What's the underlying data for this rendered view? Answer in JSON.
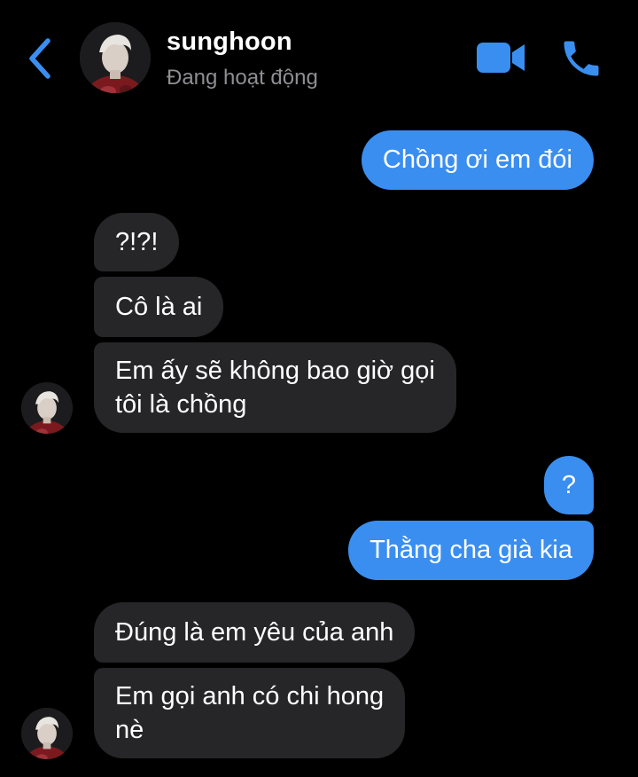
{
  "header": {
    "contact_name": "sunghoon",
    "status": "Đang hoạt động",
    "icons": {
      "back": "chevron-left-icon",
      "video": "video-camera-icon",
      "phone": "phone-icon"
    },
    "accent_color": "#3a8ef0"
  },
  "messages": [
    {
      "direction": "outgoing",
      "text": "Chồng ơi em đói"
    },
    {
      "direction": "incoming",
      "text": "?!?!"
    },
    {
      "direction": "incoming",
      "text": "Cô là ai"
    },
    {
      "direction": "incoming",
      "lines": [
        "Em ấy sẽ không bao giờ gọi",
        "tôi là chồng"
      ]
    },
    {
      "direction": "outgoing",
      "text": "?"
    },
    {
      "direction": "outgoing",
      "text": "Thằng cha già kia"
    },
    {
      "direction": "incoming",
      "text": "Đúng là em yêu của anh"
    },
    {
      "direction": "incoming",
      "lines": [
        "Em gọi anh có chi hong",
        "nè"
      ]
    }
  ],
  "colors": {
    "outgoing_bubble": "#3a8ef0",
    "incoming_bubble": "#262628",
    "background": "#000000"
  }
}
